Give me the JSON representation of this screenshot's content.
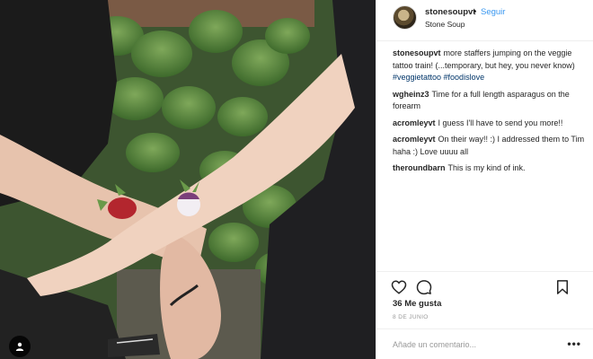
{
  "header": {
    "username": "stonesoupvt",
    "separator": "•",
    "follow_label": "Seguir",
    "location": "Stone Soup"
  },
  "comments": [
    {
      "user": "stonesoupvt",
      "text": "more staffers jumping on the veggie tattoo train! (...temporary, but hey, you never know) ",
      "tags": "#veggietattoo #foodislove"
    },
    {
      "user": "wgheinz3",
      "text": "Time for a full length asparagus on the forearm"
    },
    {
      "user": "acromleyvt",
      "text": "I guess I'll have to send you more!!"
    },
    {
      "user": "acromleyvt",
      "text": "On their way!! :) I addressed them to Tim haha :) Love uuuu all"
    },
    {
      "user": "theroundbarn",
      "text": "This is my kind of ink."
    }
  ],
  "actions": {
    "like_icon": "heart-icon",
    "comment_icon": "comment-bubble-icon",
    "save_icon": "bookmark-icon"
  },
  "likes_text": "36 Me gusta",
  "date_text": "8 DE JUNIO",
  "add_comment_placeholder": "Añade un comentario...",
  "more_label": "•••",
  "colors": {
    "link_blue": "#3897f0",
    "hashtag": "#003569",
    "muted": "#999999",
    "border": "#efefef"
  }
}
